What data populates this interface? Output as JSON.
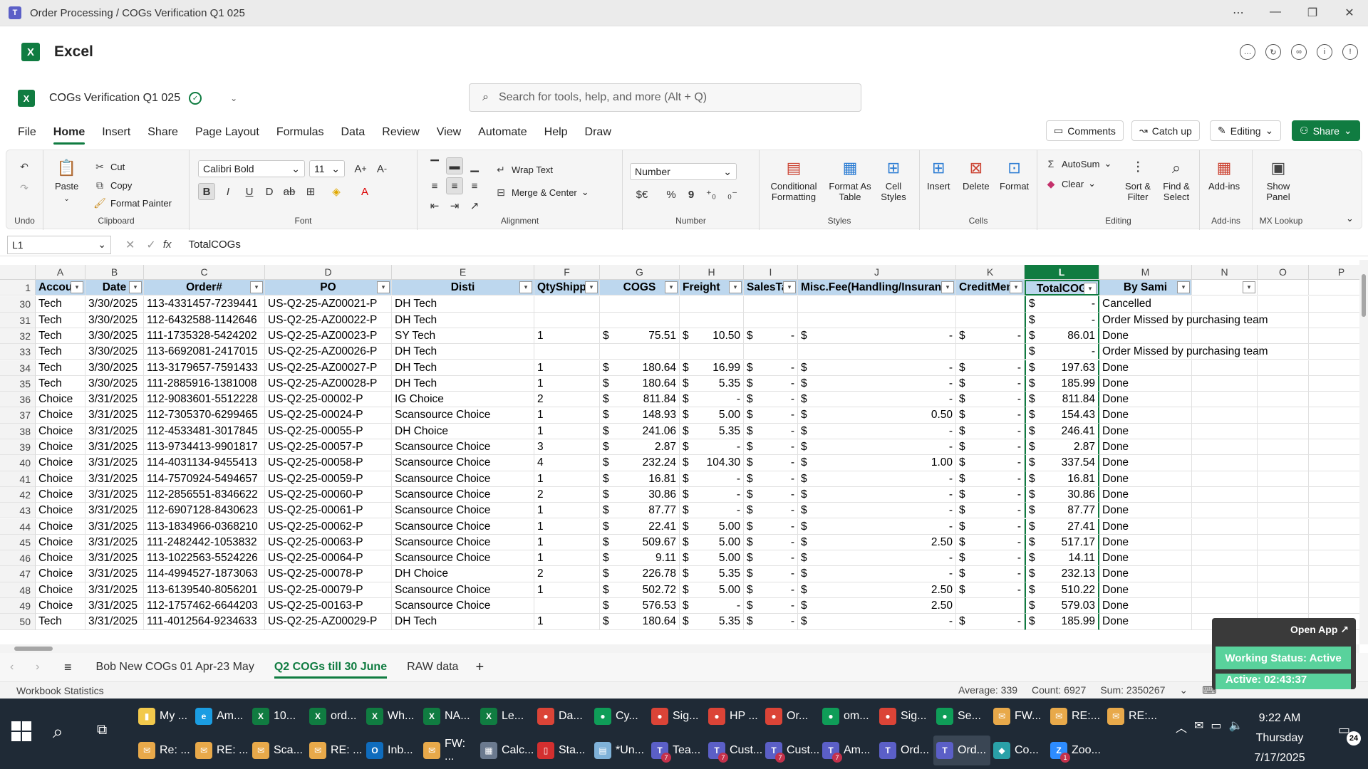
{
  "window": {
    "title": "Order Processing / COGs Verification Q1 025",
    "controls": [
      "⋯",
      "—",
      "❐",
      "✕"
    ]
  },
  "app": {
    "name": "Excel",
    "logo": "X"
  },
  "doc": {
    "name": "COGs Verification Q1 025"
  },
  "search": {
    "placeholder": "Search for tools, help, and more (Alt + Q)"
  },
  "menu": {
    "tabs": [
      "File",
      "Home",
      "Insert",
      "Share",
      "Page Layout",
      "Formulas",
      "Data",
      "Review",
      "View",
      "Automate",
      "Help",
      "Draw"
    ],
    "active": "Home"
  },
  "right_buttons": {
    "comments": "Comments",
    "catchup": "Catch up",
    "editing": "Editing",
    "share": "Share"
  },
  "ribbon": {
    "undo_label": "Undo",
    "clipboard": {
      "label": "Clipboard",
      "paste": "Paste",
      "cut": "Cut",
      "copy": "Copy",
      "format_painter": "Format Painter"
    },
    "font": {
      "label": "Font",
      "name": "Calibri Bold",
      "size": "11"
    },
    "alignment": {
      "label": "Alignment",
      "wrap": "Wrap Text",
      "merge": "Merge & Center"
    },
    "number": {
      "label": "Number",
      "format": "Number",
      "currency": "$€",
      "percent": "%",
      "comma": "9"
    },
    "styles": {
      "label": "Styles",
      "conditional": "Conditional Formatting",
      "format_table": "Format As Table",
      "cell_styles": "Cell Styles"
    },
    "cells": {
      "label": "Cells",
      "insert": "Insert",
      "delete": "Delete",
      "format": "Format"
    },
    "editing": {
      "label": "Editing",
      "autosum": "AutoSum",
      "clear": "Clear",
      "sort": "Sort & Filter",
      "find": "Find & Select"
    },
    "addins": {
      "label": "Add-ins",
      "addins": "Add-ins"
    },
    "mx": {
      "label": "MX Lookup",
      "show_panel": "Show Panel"
    }
  },
  "formula_bar": {
    "cell_ref": "L1",
    "fx": "fx",
    "value": "TotalCOGs"
  },
  "columns": [
    "A",
    "B",
    "C",
    "D",
    "E",
    "F",
    "G",
    "H",
    "I",
    "J",
    "K",
    "L",
    "M",
    "N",
    "O",
    "P"
  ],
  "headers": [
    "Accou",
    "Date",
    "Order#",
    "PO",
    "Disti",
    "QtyShipp",
    "COGS",
    "Freight",
    "SalesTa",
    "Misc.Fee(Handling/Insuranc",
    "CreditMen",
    "TotalCOG",
    "By Sami",
    "",
    "",
    ""
  ],
  "rows": [
    {
      "n": "30",
      "a": "Tech",
      "b": "3/30/2025",
      "c": "113-4331457-7239441",
      "d": "US-Q2-25-AZ00021-P",
      "e": "DH Tech",
      "f": "",
      "g": "",
      "h": "",
      "i": "",
      "j": "",
      "k": "",
      "l": "-",
      "m": "Cancelled"
    },
    {
      "n": "31",
      "a": "Tech",
      "b": "3/30/2025",
      "c": "112-6432588-1142646",
      "d": "US-Q2-25-AZ00022-P",
      "e": "DH Tech",
      "f": "",
      "g": "",
      "h": "",
      "i": "",
      "j": "",
      "k": "",
      "l": "-",
      "m": "Order Missed by purchasing team"
    },
    {
      "n": "32",
      "a": "Tech",
      "b": "3/30/2025",
      "c": "111-1735328-5424202",
      "d": "US-Q2-25-AZ00023-P",
      "e": "SY Tech",
      "f": "1",
      "g": "75.51",
      "h": "10.50",
      "i": "-",
      "j": "-",
      "k": "-",
      "l": "86.01",
      "m": "Done"
    },
    {
      "n": "33",
      "a": "Tech",
      "b": "3/30/2025",
      "c": "113-6692081-2417015",
      "d": "US-Q2-25-AZ00026-P",
      "e": "DH Tech",
      "f": "",
      "g": "",
      "h": "",
      "i": "",
      "j": "",
      "k": "",
      "l": "-",
      "m": "Order Missed by purchasing team"
    },
    {
      "n": "34",
      "a": "Tech",
      "b": "3/30/2025",
      "c": "113-3179657-7591433",
      "d": "US-Q2-25-AZ00027-P",
      "e": "DH Tech",
      "f": "1",
      "g": "180.64",
      "h": "16.99",
      "i": "-",
      "j": "-",
      "k": "-",
      "l": "197.63",
      "m": "Done"
    },
    {
      "n": "35",
      "a": "Tech",
      "b": "3/30/2025",
      "c": "111-2885916-1381008",
      "d": "US-Q2-25-AZ00028-P",
      "e": "DH Tech",
      "f": "1",
      "g": "180.64",
      "h": "5.35",
      "i": "-",
      "j": "-",
      "k": "-",
      "l": "185.99",
      "m": "Done"
    },
    {
      "n": "36",
      "a": "Choice",
      "b": "3/31/2025",
      "c": "112-9083601-5512228",
      "d": "US-Q2-25-00002-P",
      "e": "IG Choice",
      "f": "2",
      "g": "811.84",
      "h": "-",
      "i": "-",
      "j": "-",
      "k": "-",
      "l": "811.84",
      "m": "Done"
    },
    {
      "n": "37",
      "a": "Choice",
      "b": "3/31/2025",
      "c": "112-7305370-6299465",
      "d": "US-Q2-25-00024-P",
      "e": "Scansource Choice",
      "f": "1",
      "g": "148.93",
      "h": "5.00",
      "i": "-",
      "j": "0.50",
      "k": "-",
      "l": "154.43",
      "m": "Done"
    },
    {
      "n": "38",
      "a": "Choice",
      "b": "3/31/2025",
      "c": "112-4533481-3017845",
      "d": "US-Q2-25-00055-P",
      "e": "DH Choice",
      "f": "1",
      "g": "241.06",
      "h": "5.35",
      "i": "-",
      "j": "-",
      "k": "-",
      "l": "246.41",
      "m": "Done"
    },
    {
      "n": "39",
      "a": "Choice",
      "b": "3/31/2025",
      "c": "113-9734413-9901817",
      "d": "US-Q2-25-00057-P",
      "e": "Scansource Choice",
      "f": "3",
      "g": "2.87",
      "h": "-",
      "i": "-",
      "j": "-",
      "k": "-",
      "l": "2.87",
      "m": "Done"
    },
    {
      "n": "40",
      "a": "Choice",
      "b": "3/31/2025",
      "c": "114-4031134-9455413",
      "d": "US-Q2-25-00058-P",
      "e": "Scansource Choice",
      "f": "4",
      "g": "232.24",
      "h": "104.30",
      "i": "-",
      "j": "1.00",
      "k": "-",
      "l": "337.54",
      "m": "Done"
    },
    {
      "n": "41",
      "a": "Choice",
      "b": "3/31/2025",
      "c": "114-7570924-5494657",
      "d": "US-Q2-25-00059-P",
      "e": "Scansource Choice",
      "f": "1",
      "g": "16.81",
      "h": "-",
      "i": "-",
      "j": "-",
      "k": "-",
      "l": "16.81",
      "m": "Done"
    },
    {
      "n": "42",
      "a": "Choice",
      "b": "3/31/2025",
      "c": "112-2856551-8346622",
      "d": "US-Q2-25-00060-P",
      "e": "Scansource Choice",
      "f": "2",
      "g": "30.86",
      "h": "-",
      "i": "-",
      "j": "-",
      "k": "-",
      "l": "30.86",
      "m": "Done"
    },
    {
      "n": "43",
      "a": "Choice",
      "b": "3/31/2025",
      "c": "112-6907128-8430623",
      "d": "US-Q2-25-00061-P",
      "e": "Scansource Choice",
      "f": "1",
      "g": "87.77",
      "h": "-",
      "i": "-",
      "j": "-",
      "k": "-",
      "l": "87.77",
      "m": "Done"
    },
    {
      "n": "44",
      "a": "Choice",
      "b": "3/31/2025",
      "c": "113-1834966-0368210",
      "d": "US-Q2-25-00062-P",
      "e": "Scansource Choice",
      "f": "1",
      "g": "22.41",
      "h": "5.00",
      "i": "-",
      "j": "-",
      "k": "-",
      "l": "27.41",
      "m": "Done"
    },
    {
      "n": "45",
      "a": "Choice",
      "b": "3/31/2025",
      "c": "111-2482442-1053832",
      "d": "US-Q2-25-00063-P",
      "e": "Scansource Choice",
      "f": "1",
      "g": "509.67",
      "h": "5.00",
      "i": "-",
      "j": "2.50",
      "k": "-",
      "l": "517.17",
      "m": "Done"
    },
    {
      "n": "46",
      "a": "Choice",
      "b": "3/31/2025",
      "c": "113-1022563-5524226",
      "d": "US-Q2-25-00064-P",
      "e": "Scansource Choice",
      "f": "1",
      "g": "9.11",
      "h": "5.00",
      "i": "-",
      "j": "-",
      "k": "-",
      "l": "14.11",
      "m": "Done"
    },
    {
      "n": "47",
      "a": "Choice",
      "b": "3/31/2025",
      "c": "114-4994527-1873063",
      "d": "US-Q2-25-00078-P",
      "e": "DH Choice",
      "f": "2",
      "g": "226.78",
      "h": "5.35",
      "i": "-",
      "j": "-",
      "k": "-",
      "l": "232.13",
      "m": "Done"
    },
    {
      "n": "48",
      "a": "Choice",
      "b": "3/31/2025",
      "c": "113-6139540-8056201",
      "d": "US-Q2-25-00079-P",
      "e": "Scansource Choice",
      "f": "1",
      "g": "502.72",
      "h": "5.00",
      "i": "-",
      "j": "2.50",
      "k": "-",
      "l": "510.22",
      "m": "Done"
    },
    {
      "n": "49",
      "a": "Choice",
      "b": "3/31/2025",
      "c": "112-1757462-6644203",
      "d": "US-Q2-25-00163-P",
      "e": "Scansource Choice",
      "f": "",
      "g": "576.53",
      "h": "-",
      "i": "-",
      "j": "2.50",
      "k": "",
      "l": "579.03",
      "m": "Done"
    },
    {
      "n": "50",
      "a": "Tech",
      "b": "3/31/2025",
      "c": "111-4012564-9234633",
      "d": "US-Q2-25-AZ00029-P",
      "e": "DH Tech",
      "f": "1",
      "g": "180.64",
      "h": "5.35",
      "i": "-",
      "j": "-",
      "k": "-",
      "l": "185.99",
      "m": "Done"
    }
  ],
  "sheets": {
    "tabs": [
      "Bob New COGs 01 Apr-23 May",
      "Q2 COGs till 30 June",
      "RAW data"
    ],
    "active": "Q2 COGs till 30 June",
    "add": "+"
  },
  "status": {
    "workbook_stats": "Workbook Statistics",
    "average": "Average: 339",
    "count": "Count: 6927",
    "sum": "Sum: 2350267"
  },
  "widget": {
    "open_app": "Open App ↗",
    "working_status": "Working Status: Active",
    "active": "Active: 02:43:37"
  },
  "taskbar": {
    "row1": [
      {
        "label": "My ...",
        "icon": "folder-icon",
        "color": "#f2c94c",
        "glyph": "▮"
      },
      {
        "label": "Am...",
        "icon": "edge-icon",
        "color": "#1b9de2",
        "glyph": "e"
      },
      {
        "label": "10...",
        "icon": "excel-icon",
        "color": "#107c41",
        "glyph": "X"
      },
      {
        "label": "ord...",
        "icon": "excel-icon",
        "color": "#107c41",
        "glyph": "X"
      },
      {
        "label": "Wh...",
        "icon": "excel-icon",
        "color": "#107c41",
        "glyph": "X"
      },
      {
        "label": "NA...",
        "icon": "excel-icon",
        "color": "#107c41",
        "glyph": "X"
      },
      {
        "label": "Le...",
        "icon": "excel-icon",
        "color": "#107c41",
        "glyph": "X"
      },
      {
        "label": "Da...",
        "icon": "chrome-icon",
        "color": "#db4437",
        "glyph": "●"
      },
      {
        "label": "Cy...",
        "icon": "chrome-icon",
        "color": "#0f9d58",
        "glyph": "●"
      },
      {
        "label": "Sig...",
        "icon": "chrome-icon",
        "color": "#db4437",
        "glyph": "●"
      },
      {
        "label": "HP ...",
        "icon": "chrome-icon",
        "color": "#db4437",
        "glyph": "●"
      },
      {
        "label": "Or...",
        "icon": "chrome-icon",
        "color": "#db4437",
        "glyph": "●"
      },
      {
        "label": "om...",
        "icon": "chrome-icon",
        "color": "#0f9d58",
        "glyph": "●"
      },
      {
        "label": "Sig...",
        "icon": "chrome-icon",
        "color": "#db4437",
        "glyph": "●"
      },
      {
        "label": "Se...",
        "icon": "chrome-icon",
        "color": "#0f9d58",
        "glyph": "●"
      },
      {
        "label": "FW...",
        "icon": "mail-icon",
        "color": "#e8a94a",
        "glyph": "✉"
      },
      {
        "label": "RE:...",
        "icon": "mail-icon",
        "color": "#e8a94a",
        "glyph": "✉"
      },
      {
        "label": "RE:...",
        "icon": "mail-icon",
        "color": "#e8a94a",
        "glyph": "✉"
      }
    ],
    "row2": [
      {
        "label": "Re: ...",
        "icon": "mail-icon",
        "color": "#e8a94a",
        "glyph": "✉"
      },
      {
        "label": "RE: ...",
        "icon": "mail-icon",
        "color": "#e8a94a",
        "glyph": "✉"
      },
      {
        "label": "Sca...",
        "icon": "mail-icon",
        "color": "#e8a94a",
        "glyph": "✉"
      },
      {
        "label": "RE: ...",
        "icon": "mail-icon",
        "color": "#e8a94a",
        "glyph": "✉"
      },
      {
        "label": "Inb...",
        "icon": "outlook-icon",
        "color": "#0f6cbd",
        "glyph": "O"
      },
      {
        "label": "FW: ...",
        "icon": "mail-icon",
        "color": "#e8a94a",
        "glyph": "✉"
      },
      {
        "label": "Calc...",
        "icon": "calculator-icon",
        "color": "#6b7a8f",
        "glyph": "▦"
      },
      {
        "label": "Sta...",
        "icon": "pdf-icon",
        "color": "#d32f2f",
        "glyph": "▯"
      },
      {
        "label": "*Un...",
        "icon": "notepad-icon",
        "color": "#7fb2d9",
        "glyph": "▤"
      },
      {
        "label": "Tea...",
        "icon": "teams-icon",
        "color": "#5b5fc7",
        "glyph": "T",
        "badge": "7"
      },
      {
        "label": "Cust...",
        "icon": "teams-icon",
        "color": "#5b5fc7",
        "glyph": "T",
        "badge": "7"
      },
      {
        "label": "Cust...",
        "icon": "teams-icon",
        "color": "#5b5fc7",
        "glyph": "T",
        "badge": "7"
      },
      {
        "label": "Am...",
        "icon": "teams-icon",
        "color": "#5b5fc7",
        "glyph": "T",
        "badge": "7"
      },
      {
        "label": "Ord...",
        "icon": "teams-icon",
        "color": "#5b5fc7",
        "glyph": "T"
      },
      {
        "label": "Ord...",
        "icon": "teams-icon",
        "color": "#5b5fc7",
        "glyph": "T",
        "active": true
      },
      {
        "label": "Co...",
        "icon": "app-icon",
        "color": "#2aa1a8",
        "glyph": "◆"
      },
      {
        "label": "Zoo...",
        "icon": "zoom-icon",
        "color": "#2d8cff",
        "glyph": "Z",
        "badge": "1"
      }
    ]
  },
  "tray": {
    "time": "9:22 AM",
    "day": "Thursday",
    "date": "7/17/2025",
    "notifications": "24"
  }
}
